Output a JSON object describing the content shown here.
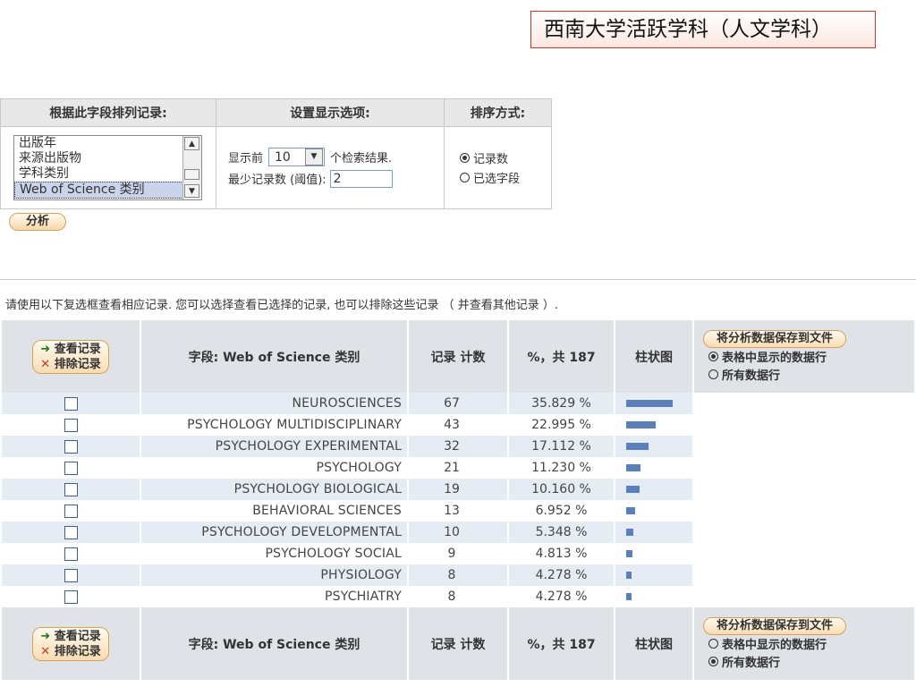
{
  "slide_title": "西南大学活跃学科（人文学科）",
  "options": {
    "col1_header": "根据此字段排列记录:",
    "col2_header": "设置显示选项:",
    "col3_header": "排序方式:",
    "fields": [
      "出版年",
      "来源出版物",
      "学科类别",
      "Web of Science 类别"
    ],
    "selected_field": "Web of Science 类别",
    "show_top_prefix": "显示前",
    "show_top_value": "10",
    "show_top_suffix": "个检索结果.",
    "min_records_label": "最少记录数 (阈值):",
    "min_records_value": "2",
    "sort_records": "记录数",
    "sort_selected": "已选字段",
    "sort_checked": "记录数",
    "analyze_button": "分析"
  },
  "instruction": "请使用以下复选框查看相应记录. 您可以选择查看已选择的记录, 也可以排除这些记录 （ 并查看其他记录 ）.",
  "results": {
    "view_records": "查看记录",
    "exclude_records": "排除记录",
    "field_header": "字段: Web of Science 类别",
    "count_header": "记录 计数",
    "percent_header": "%，共 187",
    "chart_header": "柱状图",
    "save_button": "将分析数据保存到文件",
    "save_option_table": "表格中显示的数据行",
    "save_option_all": "所有数据行",
    "total": 187,
    "rows": [
      {
        "name": "NEUROSCIENCES",
        "count": 67,
        "percent": "35.829 %"
      },
      {
        "name": "PSYCHOLOGY MULTIDISCIPLINARY",
        "count": 43,
        "percent": "22.995 %"
      },
      {
        "name": "PSYCHOLOGY EXPERIMENTAL",
        "count": 32,
        "percent": "17.112 %"
      },
      {
        "name": "PSYCHOLOGY",
        "count": 21,
        "percent": "11.230 %"
      },
      {
        "name": "PSYCHOLOGY BIOLOGICAL",
        "count": 19,
        "percent": "10.160 %"
      },
      {
        "name": "BEHAVIORAL SCIENCES",
        "count": 13,
        "percent": "6.952 %"
      },
      {
        "name": "PSYCHOLOGY DEVELOPMENTAL",
        "count": 10,
        "percent": "5.348 %"
      },
      {
        "name": "PSYCHOLOGY SOCIAL",
        "count": 9,
        "percent": "4.813 %"
      },
      {
        "name": "PHYSIOLOGY",
        "count": 8,
        "percent": "4.278 %"
      },
      {
        "name": "PSYCHIATRY",
        "count": 8,
        "percent": "4.278 %"
      }
    ]
  },
  "colors": {
    "bar": "#5b7fb8",
    "row_alt": "#e6ecf3",
    "header_bg": "#dfe2e6"
  }
}
